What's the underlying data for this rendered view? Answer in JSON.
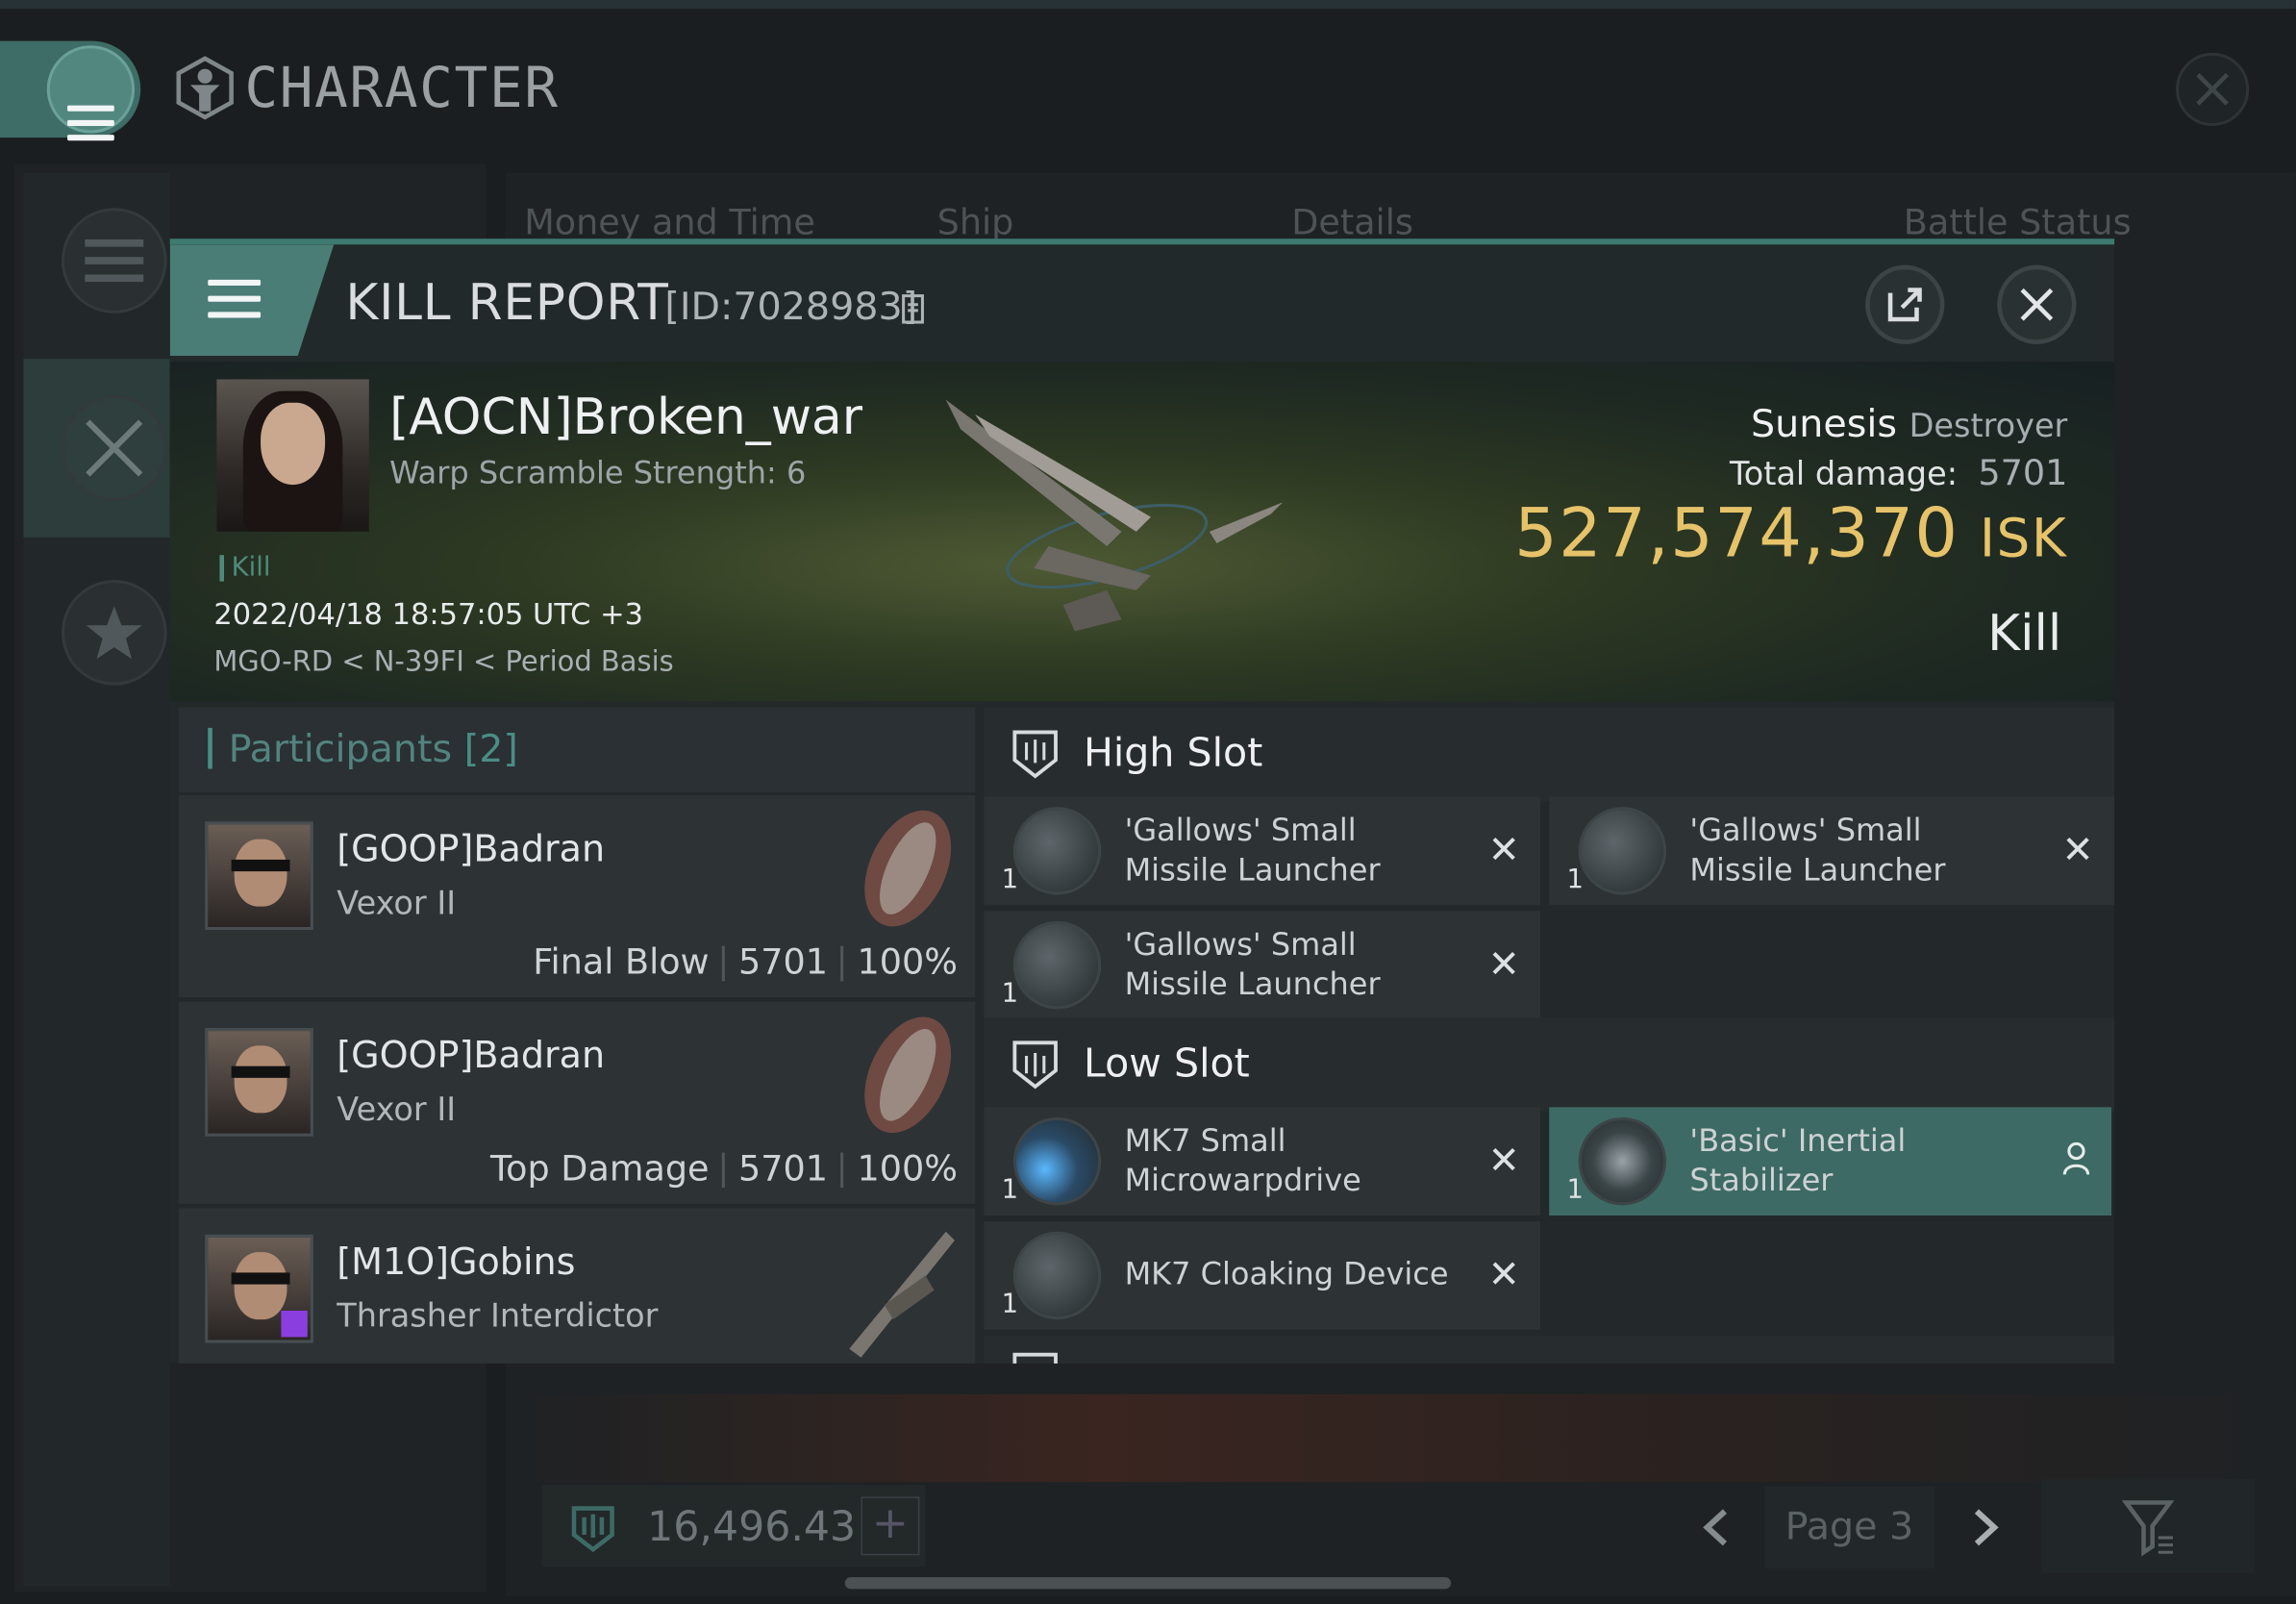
{
  "background_window": {
    "title": "CHARACTER",
    "tabs": [
      "Money and Time",
      "Ship",
      "Details",
      "Battle Status"
    ],
    "wallet_value": "16,496.43",
    "page_label": "Page 3"
  },
  "kill_report": {
    "title": "KILL REPORT",
    "id_label": "[ID:7028983]",
    "victim": {
      "name": "[AOCN]Broken_war",
      "subtitle": "Warp Scramble Strength: 6",
      "tag": "Kill",
      "datetime": "2022/04/18 18:57:05 UTC +3",
      "location": "MGO-RD < N-39FI < Period Basis"
    },
    "ship": {
      "name": "Sunesis",
      "class": "Destroyer",
      "total_damage_label": "Total damage:",
      "total_damage": "5701",
      "value": "527,574,370",
      "currency": "ISK",
      "result": "Kill"
    },
    "participants": {
      "title": "Participants",
      "count": "[2]",
      "items": [
        {
          "name": "[GOOP]Badran",
          "ship": "Vexor II",
          "role": "Final Blow",
          "damage": "5701",
          "percent": "100%"
        },
        {
          "name": "[GOOP]Badran",
          "ship": "Vexor II",
          "role": "Top Damage",
          "damage": "5701",
          "percent": "100%"
        },
        {
          "name": "[M1O]Gobins",
          "ship": "Thrasher Interdictor"
        }
      ]
    },
    "high_slot": {
      "title": "High Slot",
      "modules": [
        {
          "qty": "1",
          "line1": "'Gallows' Small",
          "line2": "Missile Launcher"
        },
        {
          "qty": "1",
          "line1": "'Gallows' Small",
          "line2": "Missile Launcher"
        },
        {
          "qty": "1",
          "line1": "'Gallows' Small",
          "line2": "Missile Launcher"
        }
      ]
    },
    "low_slot": {
      "title": "Low Slot",
      "modules": [
        {
          "qty": "1",
          "line1": "MK7 Small",
          "line2": "Microwarpdrive"
        },
        {
          "qty": "1",
          "line1": "'Basic' Inertial",
          "line2": "Stabilizer"
        },
        {
          "qty": "1",
          "line1": "MK7 Cloaking Device",
          "line2": ""
        }
      ]
    }
  },
  "colors": {
    "accent": "#4a7d75",
    "isk_gold": "#e6c36a",
    "selected_row": "#3d6a64"
  }
}
